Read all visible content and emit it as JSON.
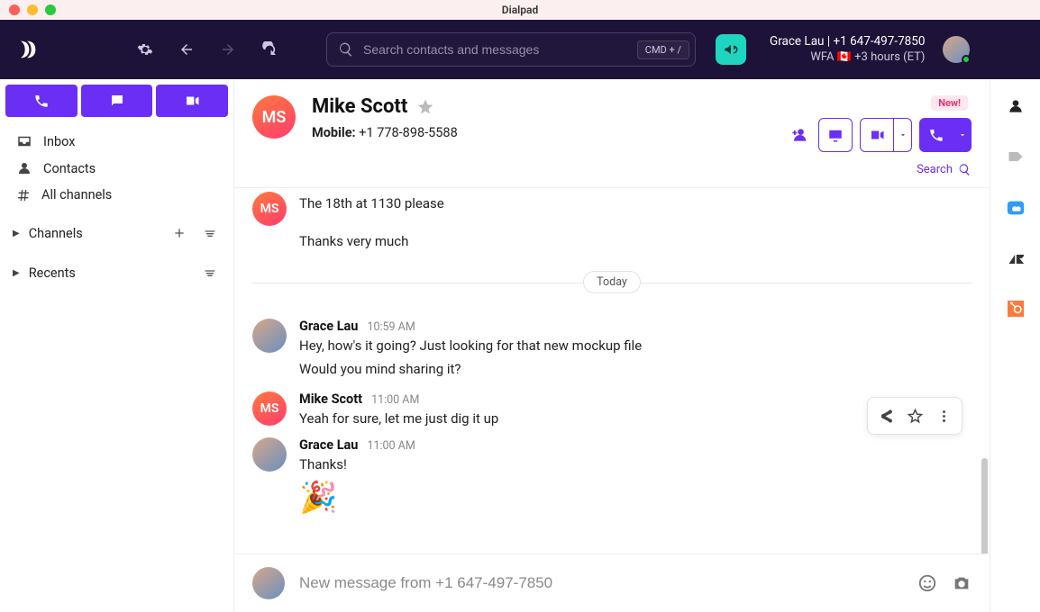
{
  "app_title": "Dialpad",
  "header": {
    "search_placeholder": "Search contacts and messages",
    "shortcut_label": "CMD + /",
    "user_name": "Grace Lau",
    "user_phone": "+1 647-497-7850",
    "status_prefix": "WFA",
    "status_flag": "🇨🇦",
    "status_tz": "+3 hours (ET)"
  },
  "sidebar": {
    "nav": [
      {
        "label": "Inbox"
      },
      {
        "label": "Contacts"
      },
      {
        "label": "All channels"
      }
    ],
    "sections": [
      {
        "label": "Channels"
      },
      {
        "label": "Recents"
      }
    ]
  },
  "contact": {
    "initials": "MS",
    "name": "Mike Scott",
    "phone_label": "Mobile:",
    "phone_number": "+1 778-898-5588",
    "new_badge": "New!",
    "search_label": "Search"
  },
  "divider_label": "Today",
  "messages": {
    "m0": {
      "initials": "MS",
      "text": "The 18th at 1130 please",
      "extra": "Thanks very much"
    },
    "m1": {
      "name": "Grace Lau",
      "time": "10:59 AM",
      "text": "Hey, how's it going? Just looking for that new mockup file",
      "extra": "Would you mind sharing it?"
    },
    "m2": {
      "name": "Mike Scott",
      "time": "11:00 AM",
      "initials": "MS",
      "text": "Yeah for sure, let me just dig it up"
    },
    "m3": {
      "name": "Grace Lau",
      "time": "11:00 AM",
      "text": "Thanks!",
      "emoji": "🎉"
    }
  },
  "composer": {
    "placeholder": "New message from +1 647-497-7850"
  }
}
